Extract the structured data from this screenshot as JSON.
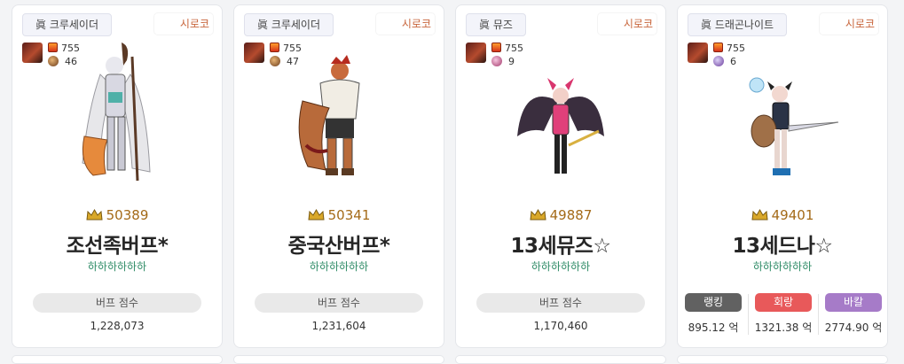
{
  "cards": [
    {
      "class": "眞 크루세이더",
      "server": "시로코",
      "item_level": "755",
      "pet_count": "46",
      "fame": "50389",
      "name": "조선족버프*",
      "guild": "하하하하하하",
      "score_label": "버프 점수",
      "score_value": "1,228,073"
    },
    {
      "class": "眞 크루세이더",
      "server": "시로코",
      "item_level": "755",
      "pet_count": "47",
      "fame": "50341",
      "name": "중국산버프*",
      "guild": "하하하하하하",
      "score_label": "버프 점수",
      "score_value": "1,231,604"
    },
    {
      "class": "眞 뮤즈",
      "server": "시로코",
      "item_level": "755",
      "pet_count": "9",
      "fame": "49887",
      "name": "13세뮤즈☆",
      "guild": "하하하하하하",
      "score_label": "버프 점수",
      "score_value": "1,170,460"
    },
    {
      "class": "眞 드래곤나이트",
      "server": "시로코",
      "item_level": "755",
      "pet_count": "6",
      "fame": "49401",
      "name": "13세드나☆",
      "guild": "하하하하하하",
      "damage": [
        {
          "label": "랭킹",
          "value": "895.12 억",
          "color": "#616161"
        },
        {
          "label": "회랑",
          "value": "1321.38 억",
          "color": "#e8595a"
        },
        {
          "label": "바칼",
          "value": "2774.90 억",
          "color": "#a67bc8"
        }
      ]
    }
  ],
  "icons": {
    "fame": "crown-icon",
    "item_level": "fire-icon",
    "pet": "creature-icon"
  }
}
